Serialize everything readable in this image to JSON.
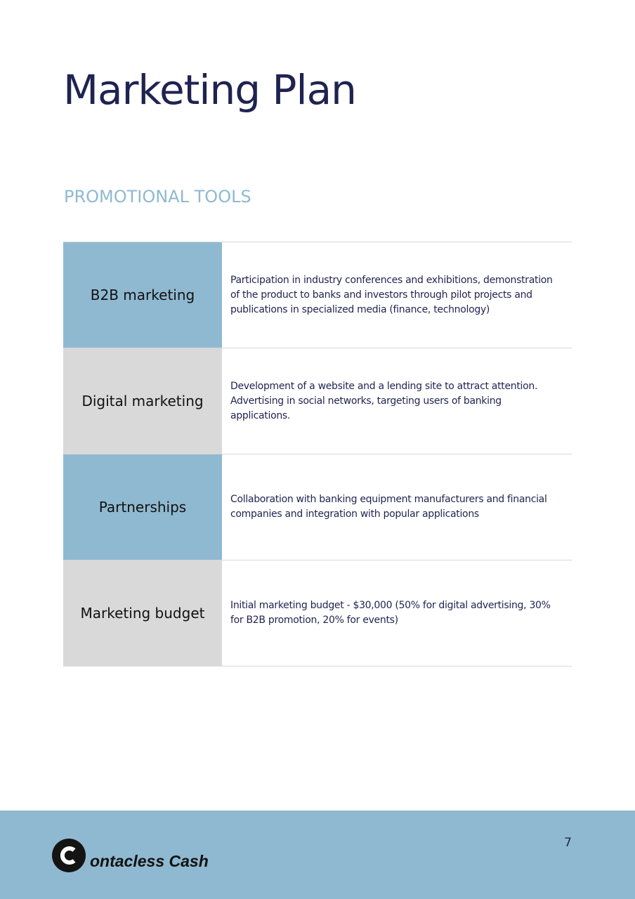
{
  "page": {
    "title": "Marketing Plan",
    "section_title": "PROMOTIONAL TOOLS",
    "page_number": "7"
  },
  "tools": [
    {
      "name": "B2B marketing",
      "description": "Participation in industry conferences and exhibitions, demonstration of the product to banks and investors through pilot projects and publications in specialized media (finance, technology)"
    },
    {
      "name": "Digital marketing",
      "description": "Development of a website and a lending site to attract attention. Advertising in social networks, targeting users of banking applications."
    },
    {
      "name": "Partnerships",
      "description": "Collaboration with banking equipment manufacturers and financial companies and integration with popular applications"
    },
    {
      "name": "Marketing budget",
      "description": "Initial marketing budget - $30,000 (50% for digital advertising, 30% for B2B promotion, 20% for events)"
    }
  ],
  "footer": {
    "logo_text": "ontacless Cash",
    "logo_icon": "c-logo-icon"
  },
  "colors": {
    "title": "#1f2350",
    "section_title": "#8fb9d0",
    "accent_blue": "#8fb9d0",
    "neutral_gray": "#d9d9d9"
  }
}
